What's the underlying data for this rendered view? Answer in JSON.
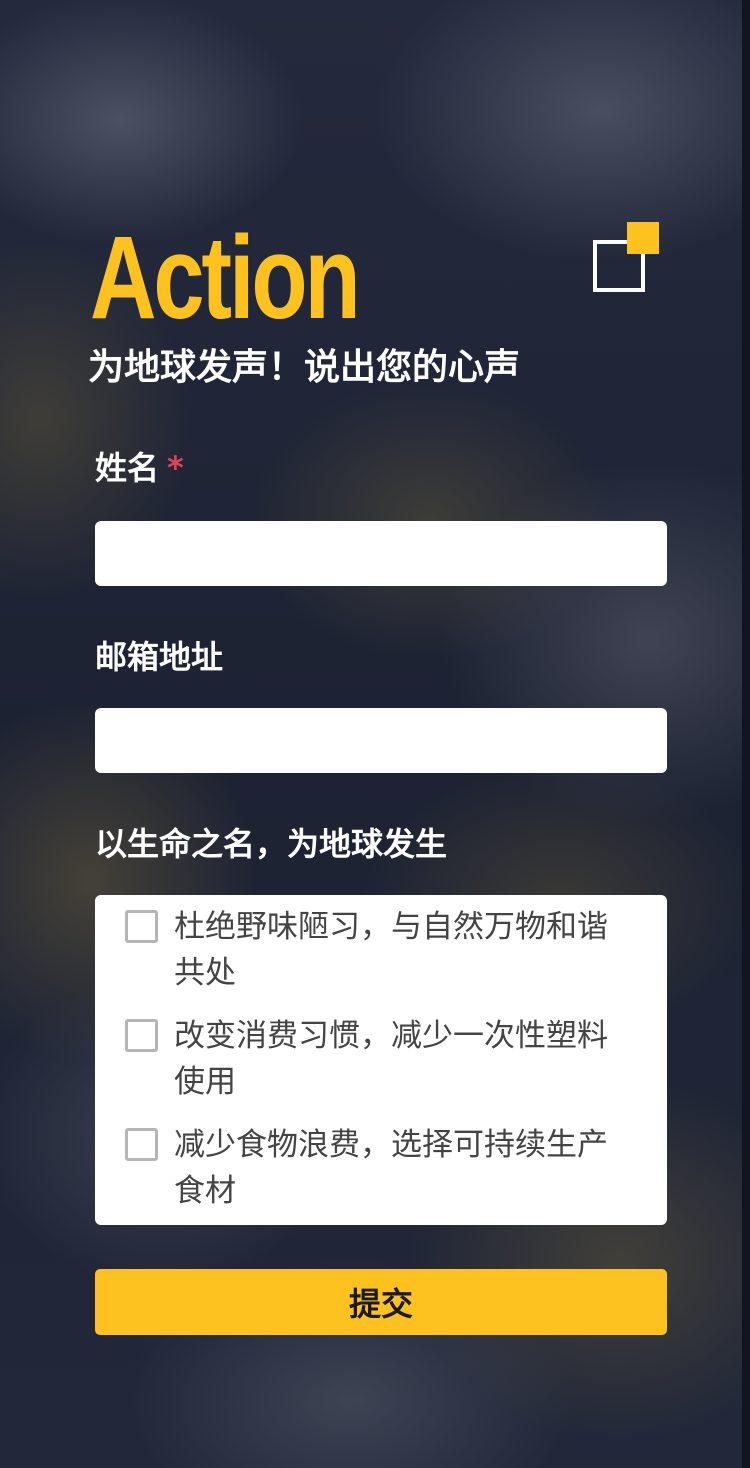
{
  "brand": {
    "title": "Action",
    "logo_icon": "overlapping-squares-icon",
    "accent_color": "#fdc21f"
  },
  "header": {
    "subtitle": "为地球发声！说出您的心声"
  },
  "form": {
    "name": {
      "label": "姓名",
      "required_mark": "*",
      "value": "",
      "placeholder": ""
    },
    "email": {
      "label": "邮箱地址",
      "value": "",
      "placeholder": ""
    },
    "pledges": {
      "label": "以生命之名，为地球发生",
      "options": [
        {
          "label": "杜绝野味陋习，与自然万物和谐共处",
          "checked": false
        },
        {
          "label": "改变消费习惯，减少一次性塑料使用",
          "checked": false
        },
        {
          "label": "减少食物浪费，选择可持续生产食材",
          "checked": false
        }
      ]
    },
    "submit_label": "提交"
  }
}
